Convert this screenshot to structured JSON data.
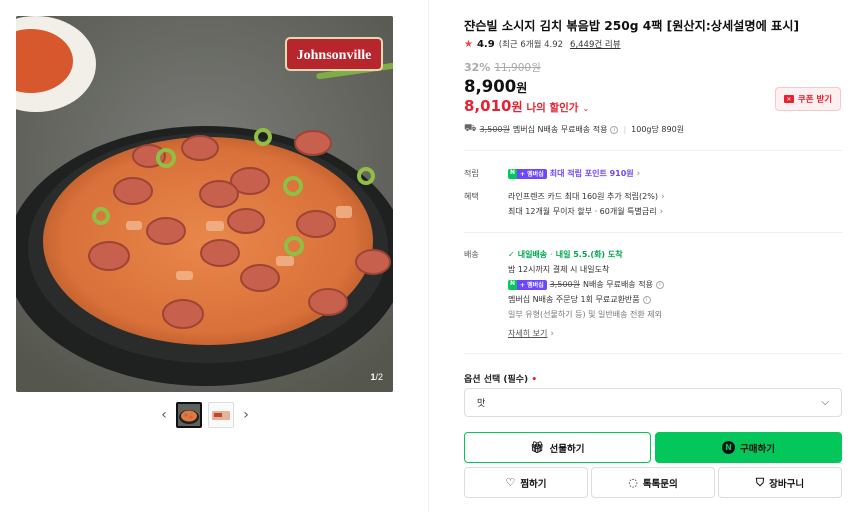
{
  "gallery": {
    "brand_logo": "Johnsonville",
    "counter_current": "1",
    "counter_total": "/2",
    "prev_icon": "‹",
    "next_icon": "›"
  },
  "product": {
    "title": "쟌슨빌 소시지 김치 볶음밥 250g 4팩 [원산지:상세설명에 표시]",
    "rating": "4.9",
    "rating_recent": "(최근 6개월 4.92",
    "review_count": "6,449건 리뷰",
    "discount_pct": "32%",
    "original_price": "11,900원",
    "price": "8,900",
    "price_unit": "원",
    "member_price": "8,010",
    "member_unit": "원",
    "member_label": "나의 할인가",
    "coupon_label": "쿠폰 받기"
  },
  "shipping": {
    "old_fee": "3,500원",
    "text": "멤버십 N배송 무료배송 적용",
    "unit_price": "100g당 890원"
  },
  "points": {
    "label": "적립",
    "badge_n": "N",
    "badge_m": "+ 멤버십",
    "text": "최대 적립 포인트 910원"
  },
  "benefits": {
    "label": "혜택",
    "line1": "라인프렌즈 카드 최대 160원 추가 적립(2%)",
    "line2": "최대 12개월 무이자 할부 · 60개월 특별금리"
  },
  "delivery": {
    "label": "배송",
    "tomorrow_label": "내일배송",
    "tomorrow_date": "내일 5.5.(화) 도착",
    "cutoff": "밤 12시까지 결제 시 내일도착",
    "free_old": "3,500원",
    "free_text": "N배송 무료배송 적용",
    "exchange": "멤버십 N배송 주문당 1회 무료교환반품",
    "note": "일부 유형(선물하기 등) 및 일반배송 전환 제외",
    "details_link": "자세히 보기"
  },
  "option": {
    "label": "옵션 선택 (필수)",
    "required_mark": "•",
    "selected": "맛"
  },
  "actions": {
    "gift": "선물하기",
    "buy": "구매하기",
    "wish": "찜하기",
    "talk": "톡톡문의",
    "cart": "장바구니"
  },
  "colors": {
    "accent_green": "#03c75a",
    "discount_red": "#e8202f",
    "membership_purple": "#6c47ff"
  }
}
